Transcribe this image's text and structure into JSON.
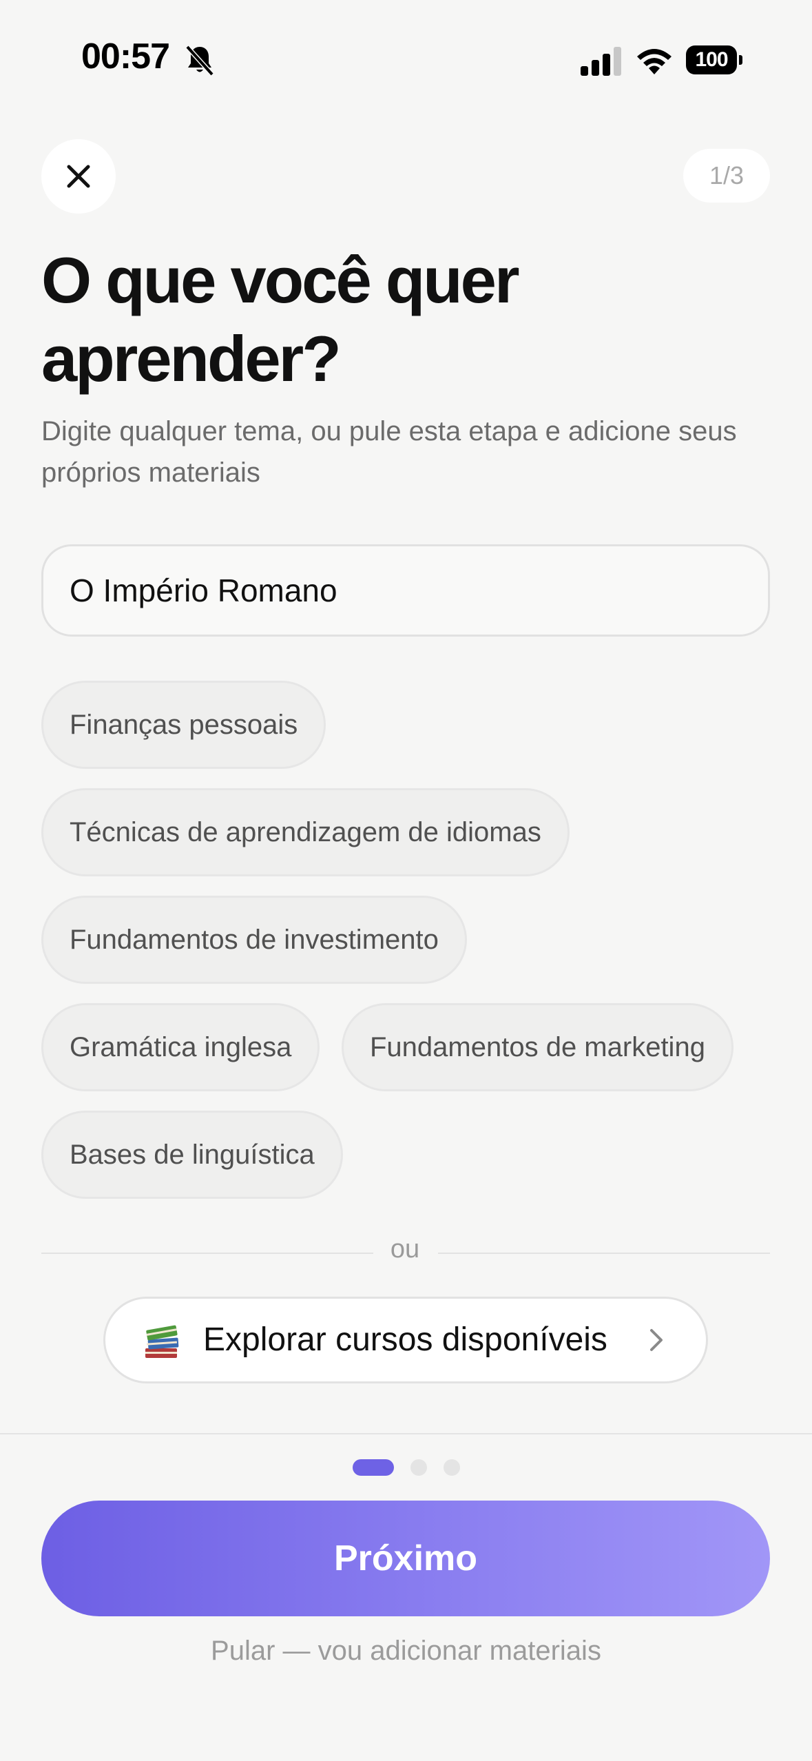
{
  "status_bar": {
    "time": "00:57",
    "battery": "100"
  },
  "header": {
    "step_indicator": "1/3"
  },
  "main": {
    "title": "O que você quer aprender?",
    "subtitle": "Digite qualquer tema, ou pule esta etapa e adicione seus próprios materiais",
    "topic_input_value": "O Império Romano",
    "suggestions": [
      "Finanças pessoais",
      "Técnicas de aprendizagem de idiomas",
      "Fundamentos de investimento",
      "Gramática inglesa",
      "Fundamentos de marketing",
      "Bases de linguística"
    ],
    "divider_text": "ou",
    "explore_label": "Explorar cursos disponíveis"
  },
  "footer": {
    "current_page": 1,
    "total_pages": 3,
    "next_label": "Próximo",
    "skip_label": "Pular — vou adicionar materiais"
  },
  "colors": {
    "accent": "#6e62e5",
    "accent_light": "#a196f7",
    "background": "#f6f6f5"
  },
  "icons": [
    "bell-slash-icon",
    "signal-icon",
    "wifi-icon",
    "battery-icon",
    "close-icon",
    "books-icon",
    "chevron-right-icon"
  ]
}
